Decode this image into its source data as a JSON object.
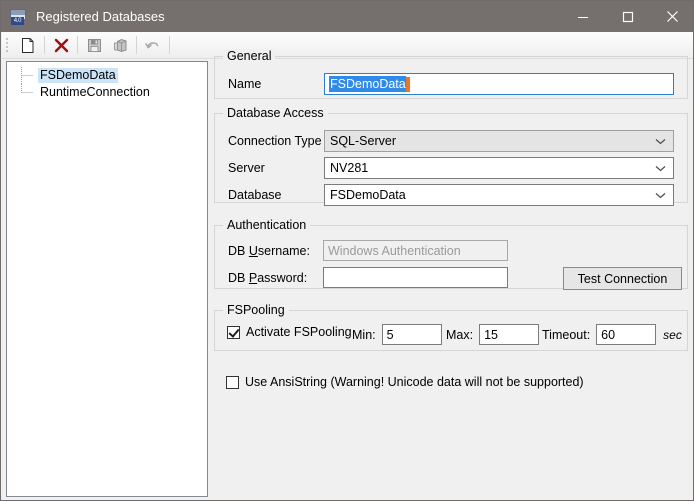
{
  "window": {
    "title": "Registered Databases",
    "icon": "database-4-icon",
    "minimize_label": "Minimize",
    "maximize_label": "Maximize",
    "close_label": "Close"
  },
  "toolbar": {
    "items": [
      {
        "name": "new-button",
        "icon": "new-document-icon"
      },
      {
        "name": "delete-button",
        "icon": "red-x-icon"
      },
      {
        "name": "save-button",
        "icon": "floppy-disk-icon"
      },
      {
        "name": "copy-button",
        "icon": "copy-stack-icon"
      },
      {
        "name": "undo-button",
        "icon": "undo-arrow-icon"
      }
    ]
  },
  "tree": {
    "nodes": [
      {
        "label": "FSDemoData",
        "selected": true
      },
      {
        "label": "RuntimeConnection",
        "selected": false
      }
    ]
  },
  "general": {
    "title": "General",
    "name_label": "Name",
    "name_value": "FSDemoData"
  },
  "database_access": {
    "title": "Database Access",
    "connection_type_label": "Connection Type",
    "connection_type_value": "SQL-Server",
    "server_label": "Server",
    "server_value": "NV281",
    "database_label": "Database",
    "database_value": "FSDemoData"
  },
  "authentication": {
    "title": "Authentication",
    "username_label_pre": "DB ",
    "username_label_accel": "U",
    "username_label_post": "sername:",
    "username_placeholder": "Windows Authentication",
    "password_label_pre": "DB ",
    "password_label_accel": "P",
    "password_label_post": "assword:",
    "password_value": "",
    "test_connection_label": "Test Connection"
  },
  "fspooling": {
    "title": "FSPooling",
    "activate_label": "Activate FSPooling",
    "activate_checked": true,
    "min_label": "Min:",
    "min_value": "5",
    "max_label": "Max:",
    "max_value": "15",
    "timeout_label": "Timeout:",
    "timeout_value": "60",
    "unit_label": "sec"
  },
  "ansistring": {
    "label": "Use AnsiString (Warning! Unicode data will not be supported)",
    "checked": false
  },
  "colors": {
    "titlebar": "#756f6e",
    "form_bg": "#f0f0f0",
    "selection": "#2f8ae8",
    "caret": "#e8772a",
    "tree_selection": "#cce4f7",
    "delete_icon": "#9e0d12"
  }
}
